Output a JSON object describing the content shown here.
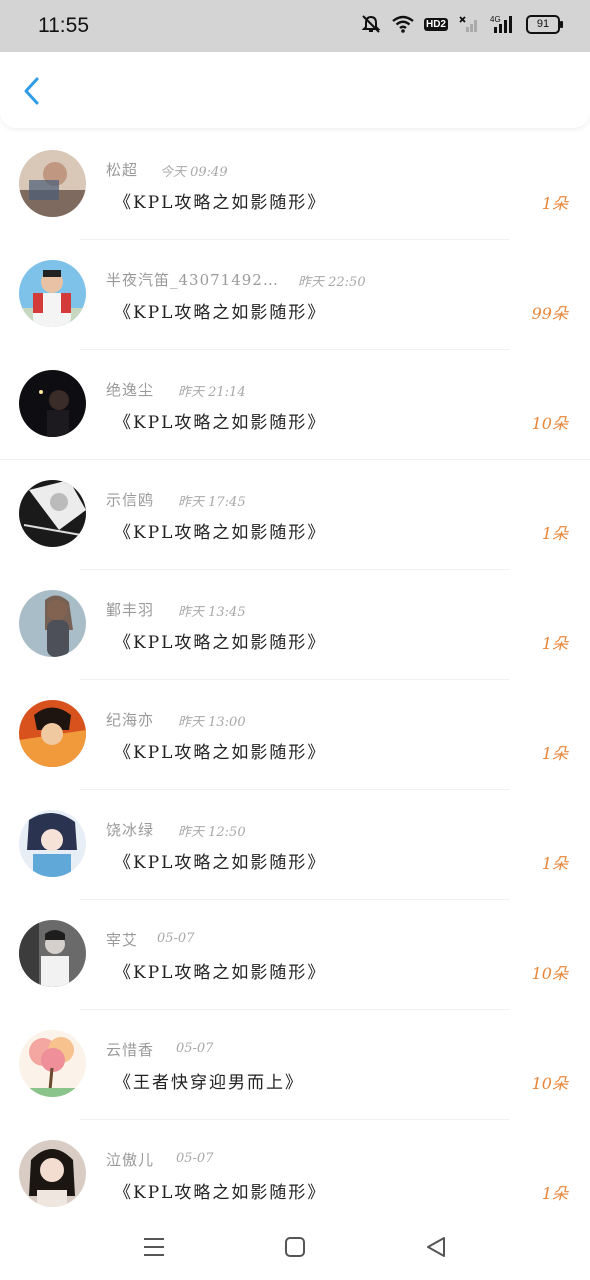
{
  "status": {
    "time": "11:55",
    "battery": "91",
    "network": "4G",
    "hd_label": "HD2"
  },
  "header": {
    "back_icon": "chevron-left-icon"
  },
  "items": [
    {
      "name": "松超",
      "time": "今天 09:49",
      "title": "《KPL攻略之如影随形》",
      "count": "1朵",
      "avatar": "avatar-photo"
    },
    {
      "name": "半夜汽笛_43071492…",
      "time": "昨天 22:50",
      "title": "《KPL攻略之如影随形》",
      "count": "99朵",
      "avatar": "avatar-photo"
    },
    {
      "name": "绝逸尘",
      "time": "昨天 21:14",
      "title": "《KPL攻略之如影随形》",
      "count": "10朵",
      "avatar": "avatar-photo"
    },
    {
      "name": "示信鸥",
      "time": "昨天 17:45",
      "title": "《KPL攻略之如影随形》",
      "count": "1朵",
      "avatar": "avatar-photo"
    },
    {
      "name": "鄞丰羽",
      "time": "昨天 13:45",
      "title": "《KPL攻略之如影随形》",
      "count": "1朵",
      "avatar": "avatar-photo"
    },
    {
      "name": "纪海亦",
      "time": "昨天 13:00",
      "title": "《KPL攻略之如影随形》",
      "count": "1朵",
      "avatar": "avatar-photo"
    },
    {
      "name": "饶冰绿",
      "time": "昨天 12:50",
      "title": "《KPL攻略之如影随形》",
      "count": "1朵",
      "avatar": "avatar-photo"
    },
    {
      "name": "宰艾",
      "time": "05-07",
      "title": "《KPL攻略之如影随形》",
      "count": "10朵",
      "avatar": "avatar-photo"
    },
    {
      "name": "云惜香",
      "time": "05-07",
      "title": "《王者快穿迎男而上》",
      "count": "10朵",
      "avatar": "avatar-photo"
    },
    {
      "name": "泣傲儿",
      "time": "05-07",
      "title": "《KPL攻略之如影随形》",
      "count": "1朵",
      "avatar": "avatar-photo"
    }
  ],
  "colors": {
    "accent": "#2f9ce8",
    "count": "#e7863a",
    "status_bar": "#d4d4d4"
  },
  "navbar": {
    "menu_icon": "menu-icon",
    "home_icon": "home-square-icon",
    "back_icon": "triangle-back-icon"
  }
}
